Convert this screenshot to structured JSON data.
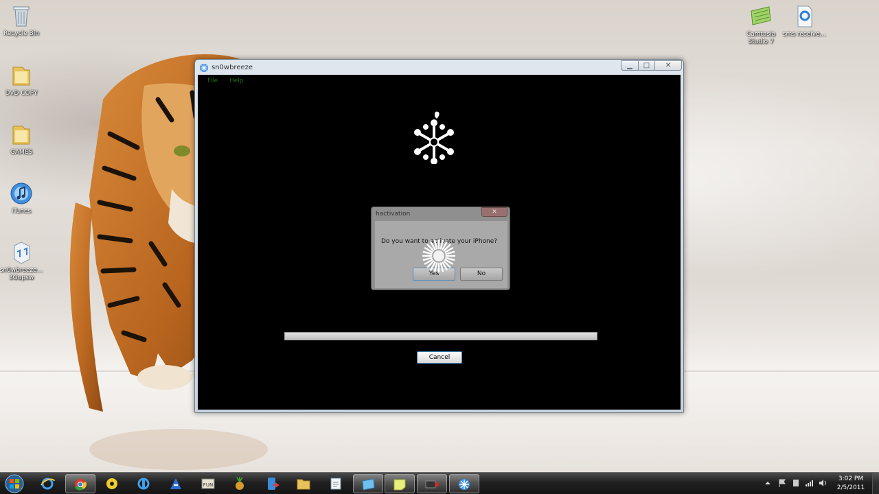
{
  "desktop": {
    "icons": [
      {
        "label": "Recycle Bin",
        "icon": "recycle-bin-icon"
      },
      {
        "label": "DVD COPY",
        "icon": "folder-icon"
      },
      {
        "label": "GAMES",
        "icon": "folder-icon"
      },
      {
        "label": "iTunes",
        "icon": "itunes-icon"
      },
      {
        "label": "sn0wbreeze... 3Gupsw",
        "icon": "ipsw-file-icon"
      },
      {
        "label": "Camtasia Studio 7",
        "icon": "camtasia-icon"
      },
      {
        "label": "sms receive...",
        "icon": "document-icon"
      }
    ]
  },
  "window": {
    "title": "sn0wbreeze",
    "menu": [
      "File",
      "Help"
    ],
    "progress": 1.0,
    "cancel_label": "Cancel"
  },
  "dialog": {
    "title": "hactivation",
    "message": "Do you want to activate your iPhone?",
    "yes_label": "Yes",
    "no_label": "No"
  },
  "taskbar": {
    "items": [
      "start-orb",
      "ie-icon",
      "chrome-icon",
      "media-icon",
      "paint-icon",
      "pin-icon",
      "fun-icon",
      "pineapple-icon",
      "phone-tool-icon",
      "folder-icon",
      "notepad-icon",
      "camtasia-icon",
      "sticky-notes-icon",
      "record-icon",
      "sn0wbreeze-icon"
    ],
    "clock_time": "3:02 PM",
    "clock_date": "2/5/2011"
  },
  "colors": {
    "menu_text": "#2b6a1d",
    "window_client": "#000000",
    "dialog": "#8f8f8f"
  }
}
